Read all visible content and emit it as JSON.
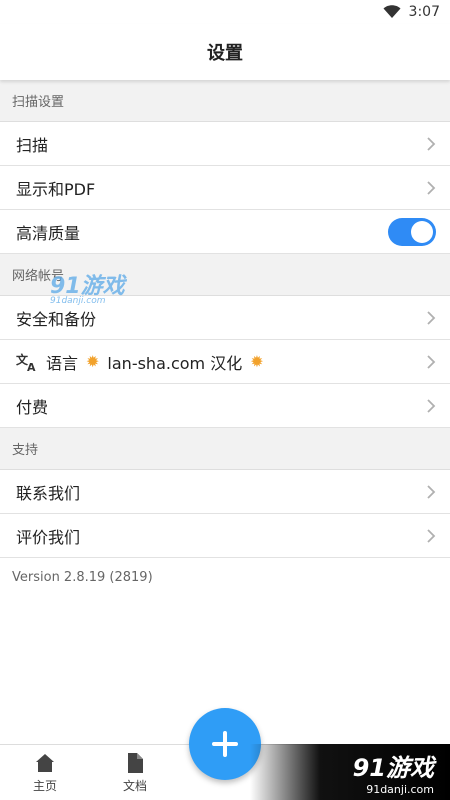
{
  "status": {
    "time": "3:07"
  },
  "header": {
    "title": "设置"
  },
  "sections": {
    "scan": {
      "title": "扫描设置",
      "items": [
        "扫描",
        "显示和PDF",
        "高清质量"
      ]
    },
    "network": {
      "title": "网络帐号",
      "items": [
        "安全和备份",
        "语言",
        "lan-sha.com 汉化",
        "付费"
      ]
    },
    "support": {
      "title": "支持",
      "items": [
        "联系我们",
        "评价我们"
      ]
    }
  },
  "hd_quality_enabled": true,
  "version": "Version 2.8.19 (2819)",
  "bottom_nav": {
    "home": "主页",
    "docs": "文档"
  },
  "watermark": {
    "brand": "91游戏",
    "site_top": "91danji.com",
    "site_bottom": "91danji.com"
  },
  "colors": {
    "accent": "#2f9df6",
    "toggle": "#2f8bf5"
  },
  "icons": [
    "wifi-icon",
    "chevron-right-icon",
    "translate-icon",
    "home-icon",
    "document-icon",
    "plus-icon"
  ]
}
